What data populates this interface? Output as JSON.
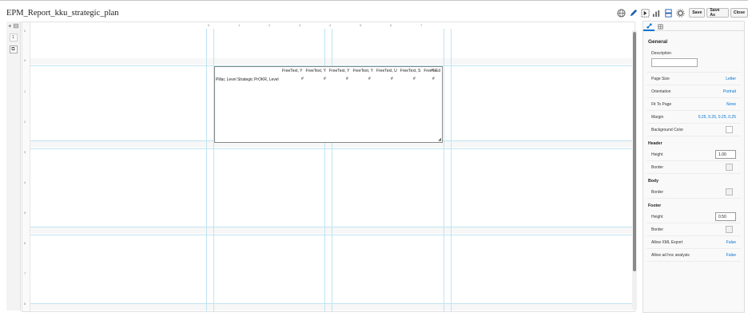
{
  "app": {
    "title": "EPM_Report_kku_strategic_plan"
  },
  "toolbar": {
    "icons": [
      "globe-icon",
      "pencil-icon",
      "insert-grid-icon",
      "chart-icon",
      "layout-icon",
      "gear-icon"
    ],
    "save_label": "Save",
    "save_as_label": "Save As",
    "close_label": "Close"
  },
  "left_rail": {
    "page_number": "1"
  },
  "ruler": {
    "horizontal": [
      "0",
      "1",
      "2",
      "3",
      "4",
      "5",
      "6",
      "7"
    ],
    "vertical": [
      "0",
      "0",
      "1",
      "2",
      "3",
      "4",
      "5",
      "6",
      "7",
      "8"
    ]
  },
  "grid": {
    "header_cells": [
      "FreeText, Y",
      "FreeText, Y",
      "FreeText, Y",
      "FreeText, Y",
      "FreeText, U",
      "FreeText, S",
      "FreeTe"
    ],
    "row_header": "Pillar, Level Strategic PrOKR, Level",
    "value_placeholder": "#",
    "corner_label": "Ed"
  },
  "panel": {
    "heading": "General",
    "description_label": "Description",
    "page_size": {
      "label": "Page Size",
      "value": "Letter"
    },
    "orientation": {
      "label": "Orientation",
      "value": "Portrait"
    },
    "fit_to_page": {
      "label": "Fit To Page",
      "value": "None"
    },
    "margin": {
      "label": "Margin",
      "value": "0.25, 0.25, 0.25, 0.25"
    },
    "background_color": {
      "label": "Background Color"
    },
    "header_section": "Header",
    "header_height": {
      "label": "Height",
      "value": "1.00"
    },
    "header_border": {
      "label": "Border"
    },
    "body_section": "Body",
    "body_border": {
      "label": "Border"
    },
    "footer_section": "Footer",
    "footer_height": {
      "label": "Height",
      "value": "0.50"
    },
    "footer_border": {
      "label": "Border"
    },
    "allow_xml": {
      "label": "Allow XML Export",
      "value": "False"
    },
    "allow_adhoc": {
      "label": "Allow ad hoc analysis",
      "value": "False"
    }
  },
  "colors": {
    "accent": "#0572ce",
    "guide": "#bfe4f2"
  }
}
